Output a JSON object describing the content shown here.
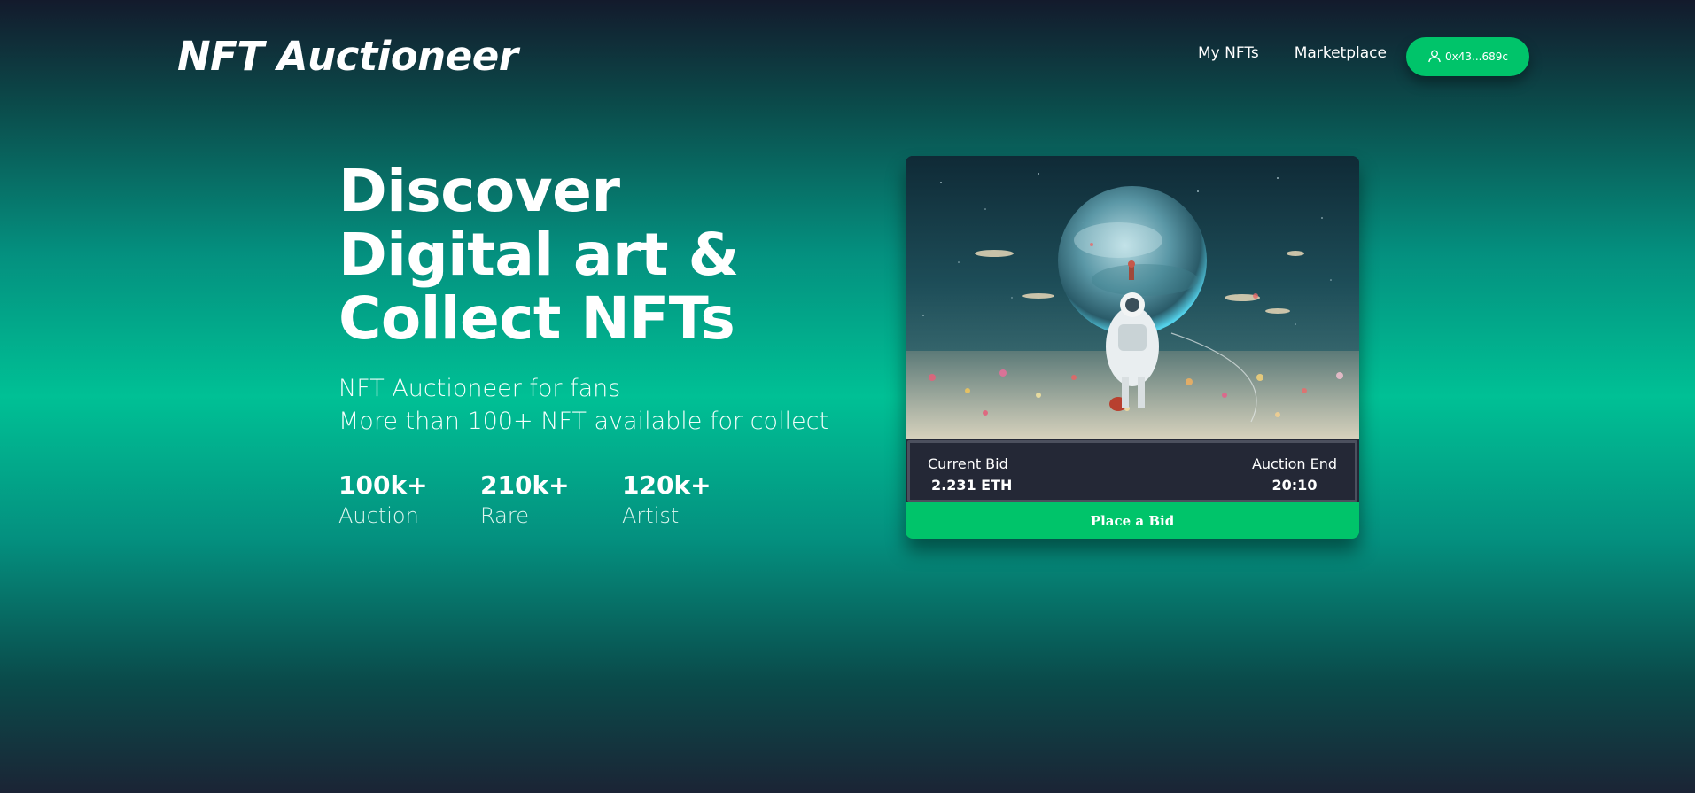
{
  "header": {
    "logo": "NFT Auctioneer",
    "nav": [
      {
        "label": "My NFTs"
      },
      {
        "label": "Marketplace"
      }
    ],
    "wallet": {
      "label": "0x43...689c",
      "icon": "user-icon"
    }
  },
  "hero": {
    "title_lines": [
      "Discover",
      "Digital art &",
      "Collect NFTs"
    ],
    "subtitle_lines": [
      "NFT Auctioneer for fans",
      "More than 100+ NFT available for collect"
    ],
    "stats": [
      {
        "value": "100k+",
        "label": "Auction"
      },
      {
        "value": "210k+",
        "label": "Rare"
      },
      {
        "value": "120k+",
        "label": "Artist"
      }
    ]
  },
  "card": {
    "image": "astronaut-planet-artwork",
    "current_bid_label": "Current Bid",
    "current_bid_value": "2.231 ETH",
    "auction_end_label": "Auction End",
    "auction_end_value": "20:10",
    "button_label": "Place a Bid"
  },
  "colors": {
    "accent": "#00c46a",
    "card_bg": "#242836"
  }
}
